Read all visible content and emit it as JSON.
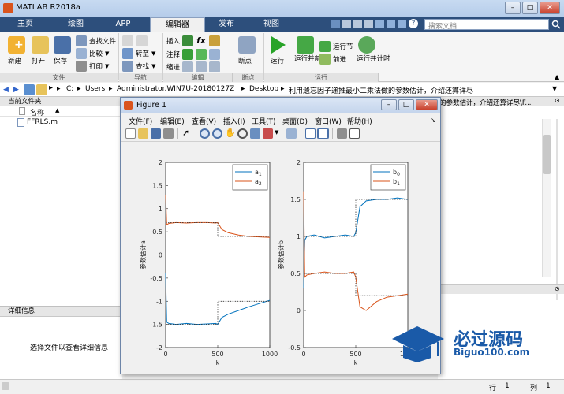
{
  "window": {
    "title": "MATLAB R2018a"
  },
  "tabs": [
    "主页",
    "绘图",
    "APP",
    "编辑器",
    "发布",
    "视图"
  ],
  "search": {
    "placeholder": "搜索文档"
  },
  "toolstrip": {
    "file": {
      "new": "新建",
      "open": "打开",
      "save": "保存",
      "find_files": "查找文件",
      "compare": "比较",
      "print": "打印",
      "group": "文件"
    },
    "nav": {
      "goto": "转至",
      "find": "查找",
      "group": "导航"
    },
    "edit": {
      "insert": "插入",
      "comment": "注释",
      "indent": "缩进",
      "group": "编辑"
    },
    "breakpoints": {
      "label": "断点",
      "group": "断点"
    },
    "run": {
      "run": "运行",
      "run_advance": "运行并前进",
      "run_section": "运行节",
      "advance": "前进",
      "run_time": "运行并计时",
      "group": "运行"
    }
  },
  "address": {
    "path": [
      "C:",
      "Users",
      "Administrator.WIN7U-20180127Z",
      "Desktop",
      "利用遗忘因子递推最小二乘法做的参数估计，介绍还算详尽"
    ],
    "right_overflow": "的参数估计，介绍还算详尽\\F..."
  },
  "current_folder": {
    "title": "当前文件夹",
    "name_header": "名称",
    "files": [
      "FFRLS.m"
    ]
  },
  "details": {
    "title": "详细信息",
    "empty_text": "选择文件以查看详细信息"
  },
  "status": {
    "row_label": "行",
    "row_value": "1",
    "col_label": "列",
    "col_value": "1"
  },
  "figure": {
    "title": "Figure 1",
    "menu": [
      "文件(F)",
      "编辑(E)",
      "查看(V)",
      "插入(I)",
      "工具(T)",
      "桌面(D)",
      "窗口(W)",
      "帮助(H)"
    ]
  },
  "chart_data": [
    {
      "type": "line",
      "xlabel": "k",
      "ylabel": "参数估计a",
      "xlim": [
        0,
        1000
      ],
      "ylim": [
        -2,
        2
      ],
      "xticks": [
        "0",
        "500",
        "1000"
      ],
      "yticks": [
        "-2",
        "-1.5",
        "-1",
        "-0.5",
        "0",
        "0.5",
        "1",
        "1.5",
        "2"
      ],
      "legend_position": "top-right",
      "series": [
        {
          "name": "a1",
          "color": "#0072bd",
          "x": [
            0,
            10,
            30,
            100,
            200,
            300,
            400,
            480,
            500,
            540,
            600,
            700,
            800,
            900,
            1000
          ],
          "y": [
            -0.4,
            -1.45,
            -1.48,
            -1.5,
            -1.48,
            -1.5,
            -1.49,
            -1.48,
            -1.5,
            -1.35,
            -1.28,
            -1.2,
            -1.12,
            -1.05,
            -0.98
          ]
        },
        {
          "name": "a2",
          "color": "#d95319",
          "x": [
            0,
            10,
            30,
            100,
            200,
            300,
            400,
            480,
            500,
            540,
            600,
            700,
            800,
            900,
            1000
          ],
          "y": [
            1.3,
            0.65,
            0.68,
            0.7,
            0.69,
            0.7,
            0.7,
            0.69,
            0.7,
            0.55,
            0.48,
            0.43,
            0.4,
            0.39,
            0.38
          ]
        },
        {
          "name": "",
          "color": "#333333",
          "dashed": true,
          "x": [
            0,
            500,
            500,
            1000
          ],
          "y": [
            -1.5,
            -1.5,
            -1.0,
            -1.0
          ]
        },
        {
          "name": "",
          "color": "#333333",
          "dashed": true,
          "x": [
            0,
            500,
            500,
            1000
          ],
          "y": [
            0.7,
            0.7,
            0.4,
            0.4
          ]
        }
      ]
    },
    {
      "type": "line",
      "xlabel": "k",
      "ylabel": "参数估计b",
      "xlim": [
        0,
        1000
      ],
      "ylim": [
        -0.5,
        2
      ],
      "xticks": [
        "0",
        "500",
        "1000"
      ],
      "yticks": [
        "-0.5",
        "0",
        "0.5",
        "1",
        "1.5",
        "2"
      ],
      "legend_position": "top-right",
      "series": [
        {
          "name": "b0",
          "color": "#0072bd",
          "x": [
            0,
            10,
            30,
            100,
            200,
            300,
            400,
            480,
            500,
            540,
            600,
            700,
            800,
            900,
            1000
          ],
          "y": [
            0.3,
            0.95,
            1.0,
            1.02,
            0.98,
            1.0,
            1.02,
            1.0,
            1.05,
            1.4,
            1.48,
            1.5,
            1.5,
            1.52,
            1.5
          ]
        },
        {
          "name": "b1",
          "color": "#d95319",
          "x": [
            0,
            10,
            30,
            100,
            200,
            300,
            400,
            480,
            500,
            540,
            600,
            700,
            800,
            900,
            1000
          ],
          "y": [
            1.6,
            0.45,
            0.48,
            0.5,
            0.52,
            0.5,
            0.5,
            0.52,
            0.45,
            0.05,
            0.0,
            0.12,
            0.18,
            0.2,
            0.22
          ]
        },
        {
          "name": "",
          "color": "#333333",
          "dashed": true,
          "x": [
            0,
            500,
            500,
            1000
          ],
          "y": [
            1.0,
            1.0,
            1.5,
            1.5
          ]
        },
        {
          "name": "",
          "color": "#333333",
          "dashed": true,
          "x": [
            0,
            500,
            500,
            1000
          ],
          "y": [
            0.5,
            0.5,
            0.2,
            0.2
          ]
        }
      ]
    }
  ],
  "watermark": {
    "title": "必过源码",
    "sub": "Biguo100.com"
  }
}
